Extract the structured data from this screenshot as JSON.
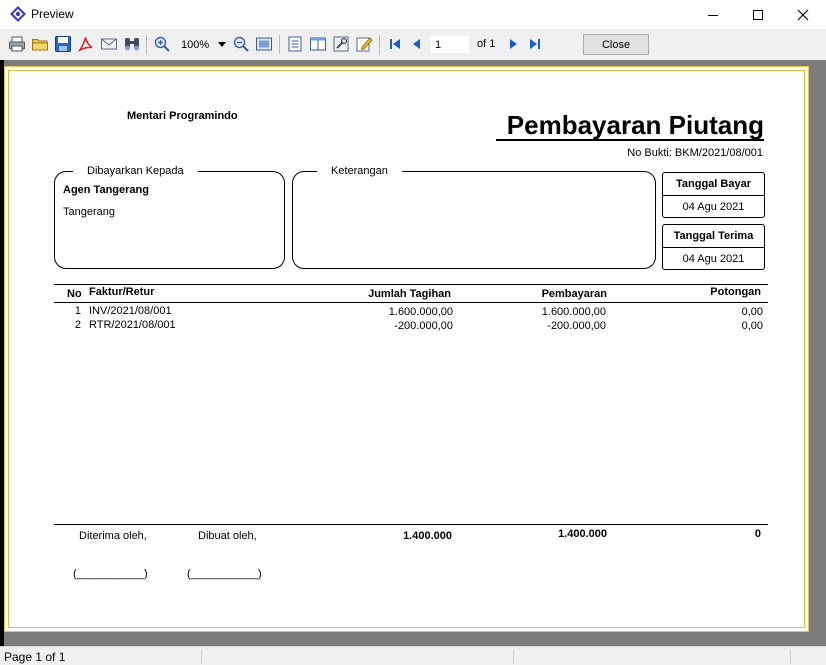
{
  "window": {
    "title": "Preview"
  },
  "toolbar": {
    "zoom": "100%",
    "page": "1",
    "of_pages": "of 1",
    "close_label": "Close",
    "icons": [
      "print-icon",
      "open-icon",
      "save-icon",
      "pdf-icon",
      "email-icon",
      "find-icon",
      "zoom-in-icon",
      "zoom-out-icon",
      "fit-page-icon",
      "single-page-icon",
      "two-page-icon",
      "settings-icon",
      "edit-icon",
      "first-page-icon",
      "prev-page-icon",
      "next-page-icon",
      "last-page-icon"
    ]
  },
  "report": {
    "company": "Mentari Programindo",
    "title": "Pembayaran Piutang",
    "doc_no": "No Bukti: BKM/2021/08/001",
    "paid_to": {
      "legend": "Dibayarkan Kepada",
      "name": "Agen Tangerang",
      "city": "Tangerang"
    },
    "notes": {
      "legend": "Keterangan",
      "text": ""
    },
    "pay_date": {
      "label": "Tanggal Bayar",
      "value": "04 Agu 2021"
    },
    "receive_date": {
      "label": "Tanggal Terima",
      "value": "04 Agu 2021"
    },
    "columns": {
      "no": "No",
      "invoice": "Faktur/Retur",
      "amount": "Jumlah Tagihan",
      "payment": "Pembayaran",
      "discount": "Potongan"
    },
    "rows": [
      {
        "no": "1",
        "invoice": "INV/2021/08/001",
        "amount": "1.600.000,00",
        "payment": "1.600.000,00",
        "discount": "0,00"
      },
      {
        "no": "2",
        "invoice": "RTR/2021/08/001",
        "amount": "-200.000,00",
        "payment": "-200.000,00",
        "discount": "0,00"
      }
    ],
    "footer": {
      "received_by": "Diterima oleh,",
      "made_by": "Dibuat oleh,",
      "signature_placeholder": "(___________)",
      "total_amount": "1.400.000",
      "total_payment": "1.400.000",
      "total_discount": "0"
    }
  },
  "status": {
    "page": "Page 1 of 1"
  },
  "colors": {
    "paper_border": "#f0c35a",
    "preview_bg": "#7b7b7b",
    "toolbar_bg": "#f0f0f0",
    "nav_blue": "#1a5fc8"
  }
}
